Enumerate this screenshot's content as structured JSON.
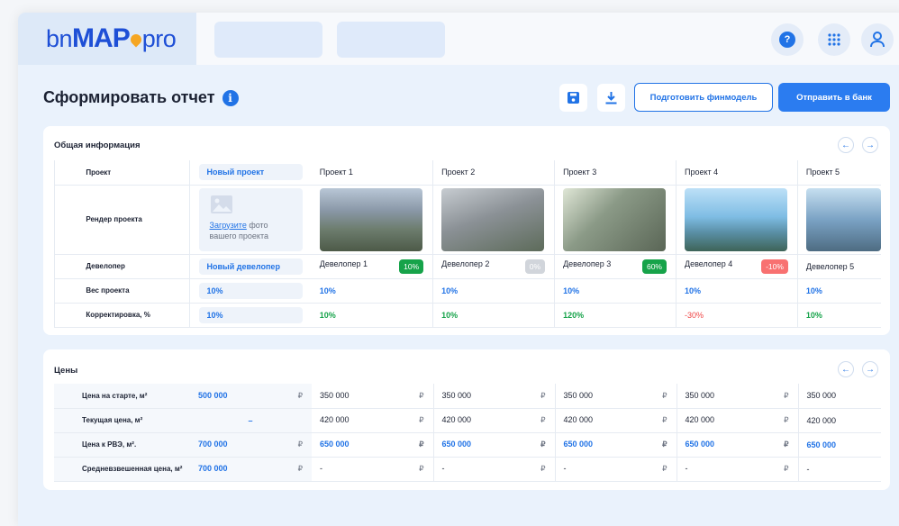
{
  "logo": {
    "part1": "bn",
    "part2": "MAP",
    "part3": "pro"
  },
  "page": {
    "title": "Сформировать отчет"
  },
  "actions": {
    "finmodel": "Подготовить финмодель",
    "send": "Отправить в банк"
  },
  "general": {
    "title": "Общая информация",
    "labels": {
      "project": "Проект",
      "render": "Рендер проекта",
      "developer": "Девелопер",
      "weight": "Вес проекта",
      "correction": "Корректировка, %"
    },
    "new_project": {
      "name": "Новый проект",
      "upload_link": "Загрузите",
      "upload_rest": " фото вашего проекта",
      "developer": "Новый девелопер",
      "weight": "10%",
      "correction": "10%"
    },
    "projects": [
      {
        "name": "Проект 1",
        "developer": "Девелопер 1",
        "badge": "10%",
        "badge_color": "#16a34a",
        "weight": "10%",
        "correction": "10%",
        "corr_kind": "green",
        "img": "city-photo-1"
      },
      {
        "name": "Проект 2",
        "developer": "Девелопер 2",
        "badge": "0%",
        "badge_color": "#d1d5db",
        "weight": "10%",
        "correction": "10%",
        "corr_kind": "green",
        "img": "city-photo-2"
      },
      {
        "name": "Проект 3",
        "developer": "Девелопер 3",
        "badge": "60%",
        "badge_color": "#16a34a",
        "weight": "10%",
        "correction": "120%",
        "corr_kind": "green",
        "img": "city-photo-3"
      },
      {
        "name": "Проект 4",
        "developer": "Девелопер 4",
        "badge": "-10%",
        "badge_color": "#f87171",
        "weight": "10%",
        "correction": "-30%",
        "corr_kind": "red",
        "img": "city-photo-4"
      },
      {
        "name": "Проект 5",
        "developer": "Девелопер 5",
        "badge": "",
        "badge_color": "",
        "weight": "10%",
        "correction": "10%",
        "corr_kind": "green",
        "img": "city-photo-5"
      }
    ]
  },
  "prices": {
    "title": "Цены",
    "currency": "₽",
    "labels": {
      "start": "Цена на старте, м²",
      "current": "Текущая цена, м²",
      "rve": "Цена к РВЭ, м².",
      "weighted": "Средневзвешенная цена, м²"
    },
    "new_project": {
      "start": "500 000",
      "current": "–",
      "rve": "700 000",
      "weighted": "700 000"
    },
    "projects": [
      {
        "start": "350 000",
        "current": "420 000",
        "rve": "650 000",
        "weighted": "-"
      },
      {
        "start": "350 000",
        "current": "420 000",
        "rve": "650 000",
        "weighted": "-"
      },
      {
        "start": "350 000",
        "current": "420 000",
        "rve": "650 000",
        "weighted": "-"
      },
      {
        "start": "350 000",
        "current": "420 000",
        "rve": "650 000",
        "weighted": "-"
      },
      {
        "start": "350 000",
        "current": "420 000",
        "rve": "650 000",
        "weighted": "-"
      }
    ]
  }
}
